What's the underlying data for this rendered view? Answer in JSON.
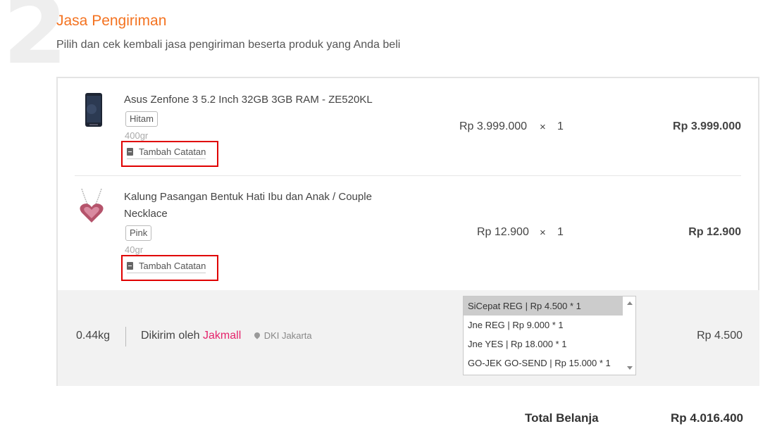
{
  "step": {
    "number": "2",
    "title": "Jasa Pengiriman",
    "subtitle": "Pilih dan cek kembali jasa pengiriman beserta produk yang Anda beli"
  },
  "products": [
    {
      "name": "Asus Zenfone 3 5.2 Inch 32GB 3GB RAM - ZE520KL",
      "variant": "Hitam",
      "weight": "400gr",
      "note_label": "Tambah Catatan",
      "unit_price": "Rp 3.999.000",
      "times": "×",
      "qty": "1",
      "subtotal": "Rp 3.999.000"
    },
    {
      "name": "Kalung Pasangan Bentuk Hati Ibu dan Anak / Couple Necklace",
      "variant": "Pink",
      "weight": "40gr",
      "note_label": "Tambah Catatan",
      "unit_price": "Rp 12.900",
      "times": "×",
      "qty": "1",
      "subtotal": "Rp 12.900"
    }
  ],
  "shipping": {
    "total_weight": "0.44kg",
    "shipped_by_label": "Dikirim oleh",
    "seller": "Jakmall",
    "location": "DKI Jakarta",
    "options": [
      "SiCepat REG | Rp 4.500 * 1",
      "Jne REG | Rp 9.000 * 1",
      "Jne YES | Rp 18.000 * 1",
      "GO-JEK GO-SEND | Rp 15.000 * 1"
    ],
    "selected_index": 0,
    "cost": "Rp 4.500"
  },
  "summary": {
    "label": "Total Belanja",
    "value": "Rp 4.016.400"
  },
  "colors": {
    "accent": "#f47321",
    "seller": "#e5246c",
    "highlight_border": "#e00000"
  }
}
